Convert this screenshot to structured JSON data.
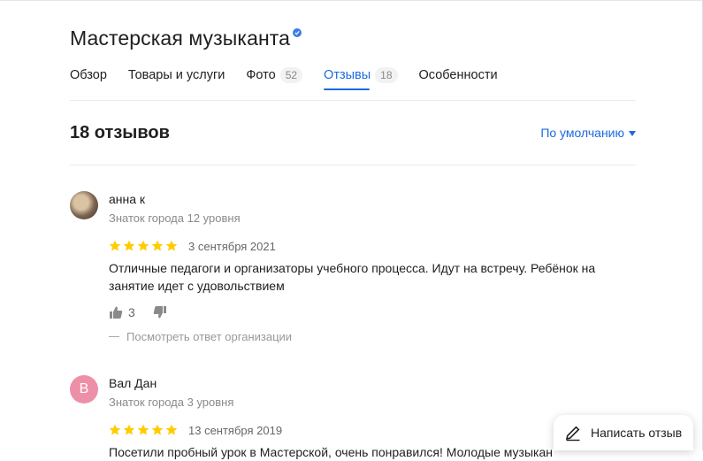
{
  "org": {
    "name": "Мастерская музыканта",
    "verified": true
  },
  "tabs": [
    {
      "label": "Обзор",
      "count": ""
    },
    {
      "label": "Товары и услуги",
      "count": ""
    },
    {
      "label": "Фото",
      "count": "52"
    },
    {
      "label": "Отзывы",
      "count": "18",
      "active": true
    },
    {
      "label": "Особенности",
      "count": ""
    }
  ],
  "reviews_header": {
    "title": "18 отзывов",
    "sort_label": "По умолчанию"
  },
  "reviews": [
    {
      "author": "анна к",
      "level": "Знаток города 12 уровня",
      "rating": 5,
      "date": "3 сентября 2021",
      "text": "Отличные педагоги и организаторы учебного процесса. Идут на встречу. Ребёнок на занятие идет с удовольствием",
      "likes": "3",
      "reply_link": "Посмотреть ответ организации",
      "avatar": "photo"
    },
    {
      "author": "Вал Дан",
      "level": "Знаток города 3 уровня",
      "rating": 5,
      "date": "13 сентября 2019",
      "text": "Посетили пробный урок в Мастерской, очень понравился! Молодые музыкан",
      "avatar_letter": "В",
      "avatar_color": "#ee8fa8"
    }
  ],
  "write_review": {
    "label": "Написать отзыв"
  },
  "colors": {
    "accent": "#1a6be0",
    "star": "#fc0",
    "verified": "#3e7ce6"
  }
}
